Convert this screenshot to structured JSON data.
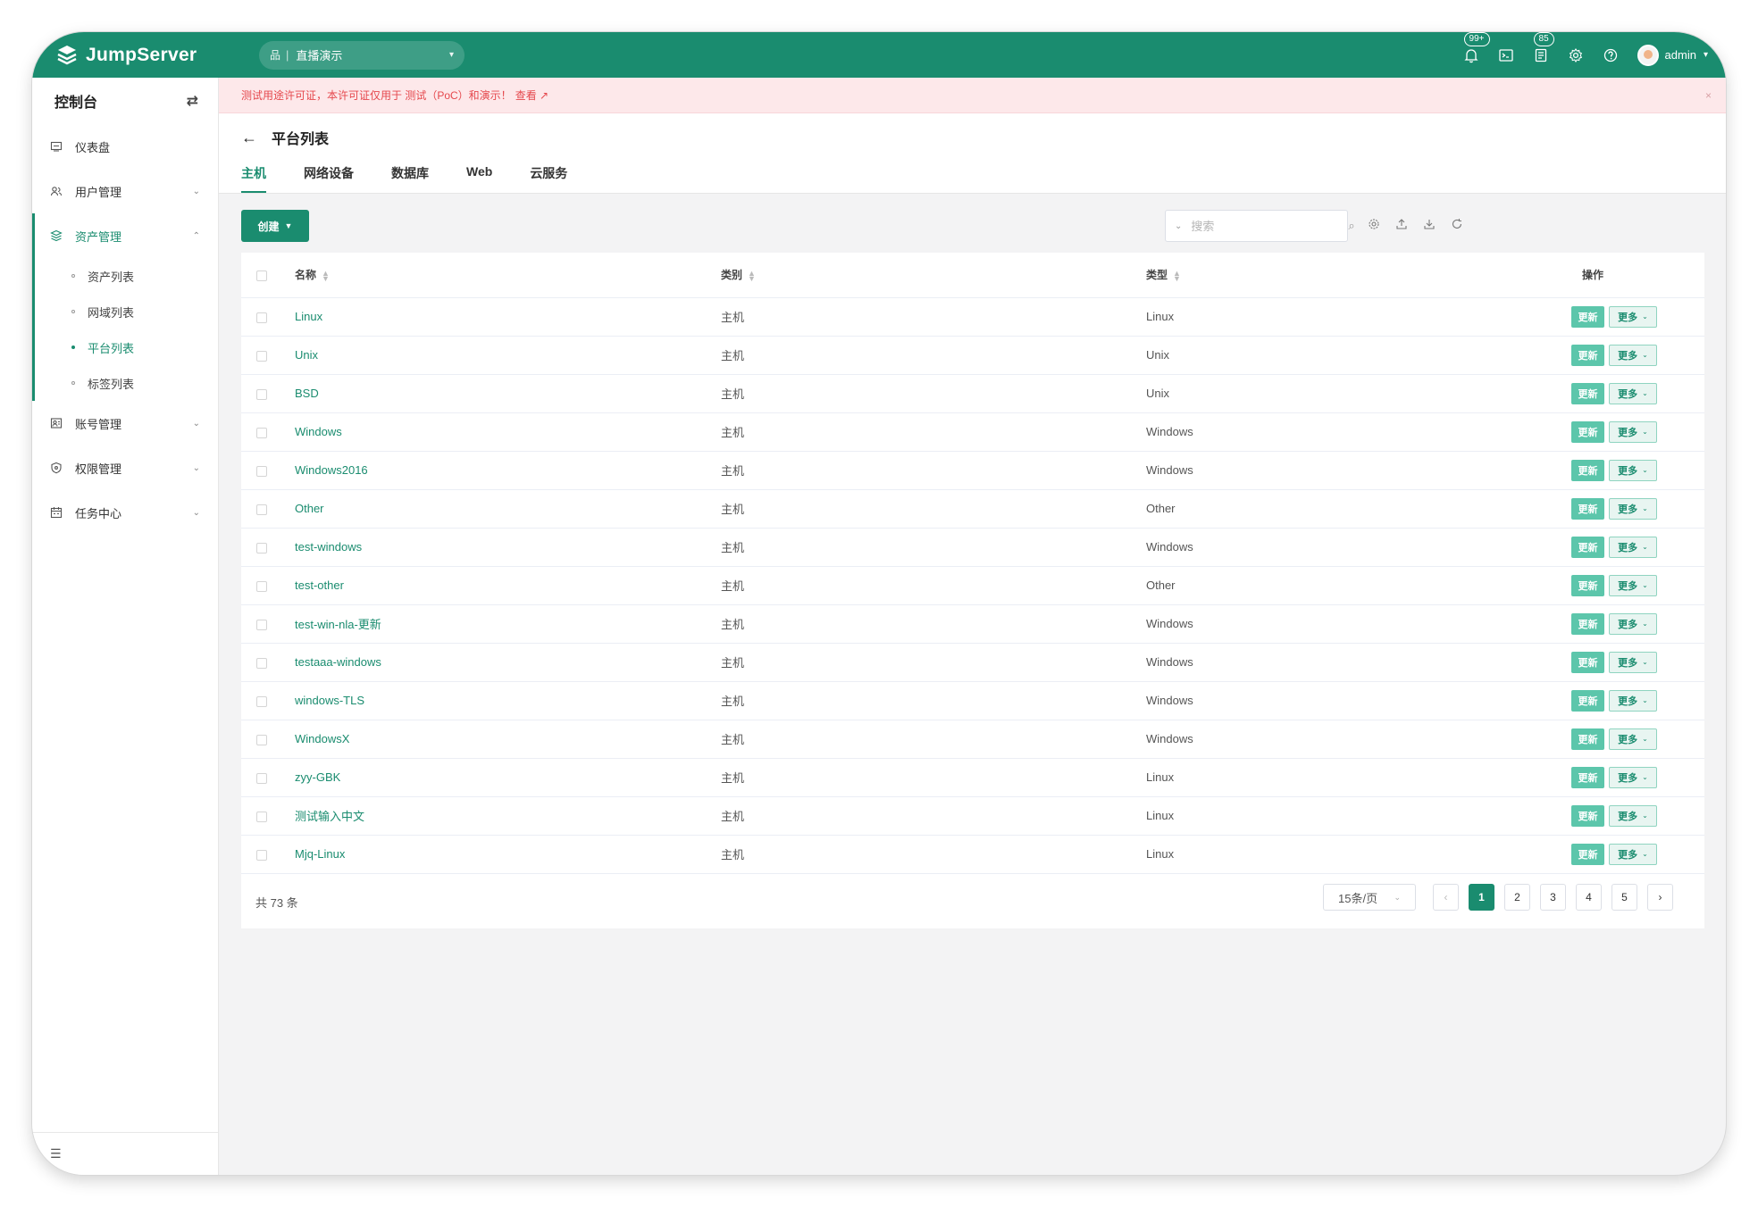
{
  "app": {
    "logo_text": "JumpServer"
  },
  "header": {
    "org_icon": "品",
    "org_sep": "|",
    "org_name": "直播演示",
    "notifications_badge": "99+",
    "tickets_badge": "85",
    "username": "admin",
    "icons": [
      "bell-icon",
      "terminal-icon",
      "ticket-icon",
      "gear-icon",
      "help-icon"
    ]
  },
  "sidebar": {
    "title": "控制台",
    "items": [
      {
        "label": "仪表盘",
        "icon": "dashboard-icon"
      },
      {
        "label": "用户管理",
        "icon": "users-icon"
      },
      {
        "label": "资产管理",
        "icon": "assets-icon"
      },
      {
        "label": "账号管理",
        "icon": "accounts-icon"
      },
      {
        "label": "权限管理",
        "icon": "shield-icon"
      },
      {
        "label": "任务中心",
        "icon": "calendar-icon"
      }
    ],
    "asset_sub_items": [
      {
        "label": "资产列表"
      },
      {
        "label": "网域列表"
      },
      {
        "label": "平台列表"
      },
      {
        "label": "标签列表"
      }
    ]
  },
  "notice": {
    "text": "测试用途许可证，本许可证仅用于 测试（PoC）和演示！",
    "link": "查看",
    "close": "×"
  },
  "page": {
    "back": "←",
    "title": "平台列表",
    "tabs": [
      {
        "label": "主机"
      },
      {
        "label": "网络设备"
      },
      {
        "label": "数据库"
      },
      {
        "label": "Web"
      },
      {
        "label": "云服务"
      }
    ]
  },
  "toolbar": {
    "create_label": "创建",
    "search_placeholder": "搜索"
  },
  "table": {
    "headers": {
      "name": "名称",
      "category": "类别",
      "type": "类型",
      "actions": "操作"
    },
    "update_label": "更新",
    "more_label": "更多",
    "rows": [
      {
        "name": "Linux",
        "category": "主机",
        "type": "Linux"
      },
      {
        "name": "Unix",
        "category": "主机",
        "type": "Unix"
      },
      {
        "name": "BSD",
        "category": "主机",
        "type": "Unix"
      },
      {
        "name": "Windows",
        "category": "主机",
        "type": "Windows"
      },
      {
        "name": "Windows2016",
        "category": "主机",
        "type": "Windows"
      },
      {
        "name": "Other",
        "category": "主机",
        "type": "Other"
      },
      {
        "name": "test-windows",
        "category": "主机",
        "type": "Windows"
      },
      {
        "name": "test-other",
        "category": "主机",
        "type": "Other"
      },
      {
        "name": "test-win-nla-更新",
        "category": "主机",
        "type": "Windows"
      },
      {
        "name": "testaaa-windows",
        "category": "主机",
        "type": "Windows"
      },
      {
        "name": "windows-TLS",
        "category": "主机",
        "type": "Windows"
      },
      {
        "name": "WindowsX",
        "category": "主机",
        "type": "Windows"
      },
      {
        "name": "zyy-GBK",
        "category": "主机",
        "type": "Linux"
      },
      {
        "name": "测试输入中文",
        "category": "主机",
        "type": "Linux"
      },
      {
        "name": "Mjq-Linux",
        "category": "主机",
        "type": "Linux"
      }
    ]
  },
  "pagination": {
    "total_text": "共 73 条",
    "page_size": "15条/页",
    "pages": [
      "1",
      "2",
      "3",
      "4",
      "5"
    ],
    "current": "1",
    "prev": "‹",
    "next": "›"
  },
  "colors": {
    "brand": "#1a8c6f",
    "update_button": "#5cc6ab",
    "notice_text": "#e5484d"
  }
}
